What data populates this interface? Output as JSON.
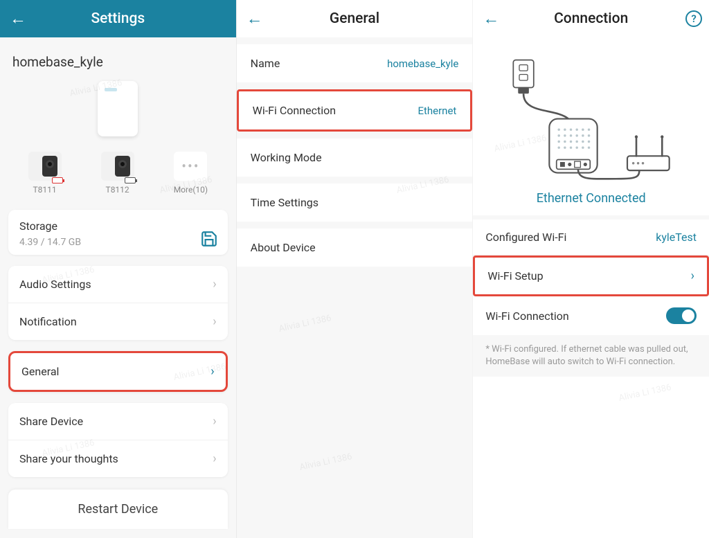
{
  "watermark": "Alivia Li 1386",
  "panel1": {
    "header": "Settings",
    "device_name": "homebase_kyle",
    "devices": [
      {
        "label": "T8111"
      },
      {
        "label": "T8112"
      },
      {
        "label": "More(10)"
      }
    ],
    "storage": {
      "title": "Storage",
      "value": "4.39 / 14.7 GB"
    },
    "rows": [
      {
        "label": "Audio Settings"
      },
      {
        "label": "Notification"
      },
      {
        "label": "General",
        "highlight": true
      },
      {
        "label": "Share Device"
      },
      {
        "label": "Share your thoughts"
      }
    ],
    "restart": "Restart Device"
  },
  "panel2": {
    "header": "General",
    "rows": [
      {
        "label": "Name",
        "value": "homebase_kyle"
      },
      {
        "label": "Wi-Fi Connection",
        "value": "Ethernet",
        "highlight": true
      },
      {
        "label": "Working Mode"
      },
      {
        "label": "Time Settings"
      },
      {
        "label": "About Device"
      }
    ]
  },
  "panel3": {
    "header": "Connection",
    "status": "Ethernet Connected",
    "rows": {
      "configured": {
        "label": "Configured Wi-Fi",
        "value": "kyleTest"
      },
      "setup": {
        "label": "Wi-Fi Setup"
      },
      "toggle": {
        "label": "Wi-Fi Connection",
        "on": true
      }
    },
    "note": "* Wi-Fi configured. If ethernet cable was pulled out, HomeBase will auto switch to Wi-Fi connection."
  }
}
